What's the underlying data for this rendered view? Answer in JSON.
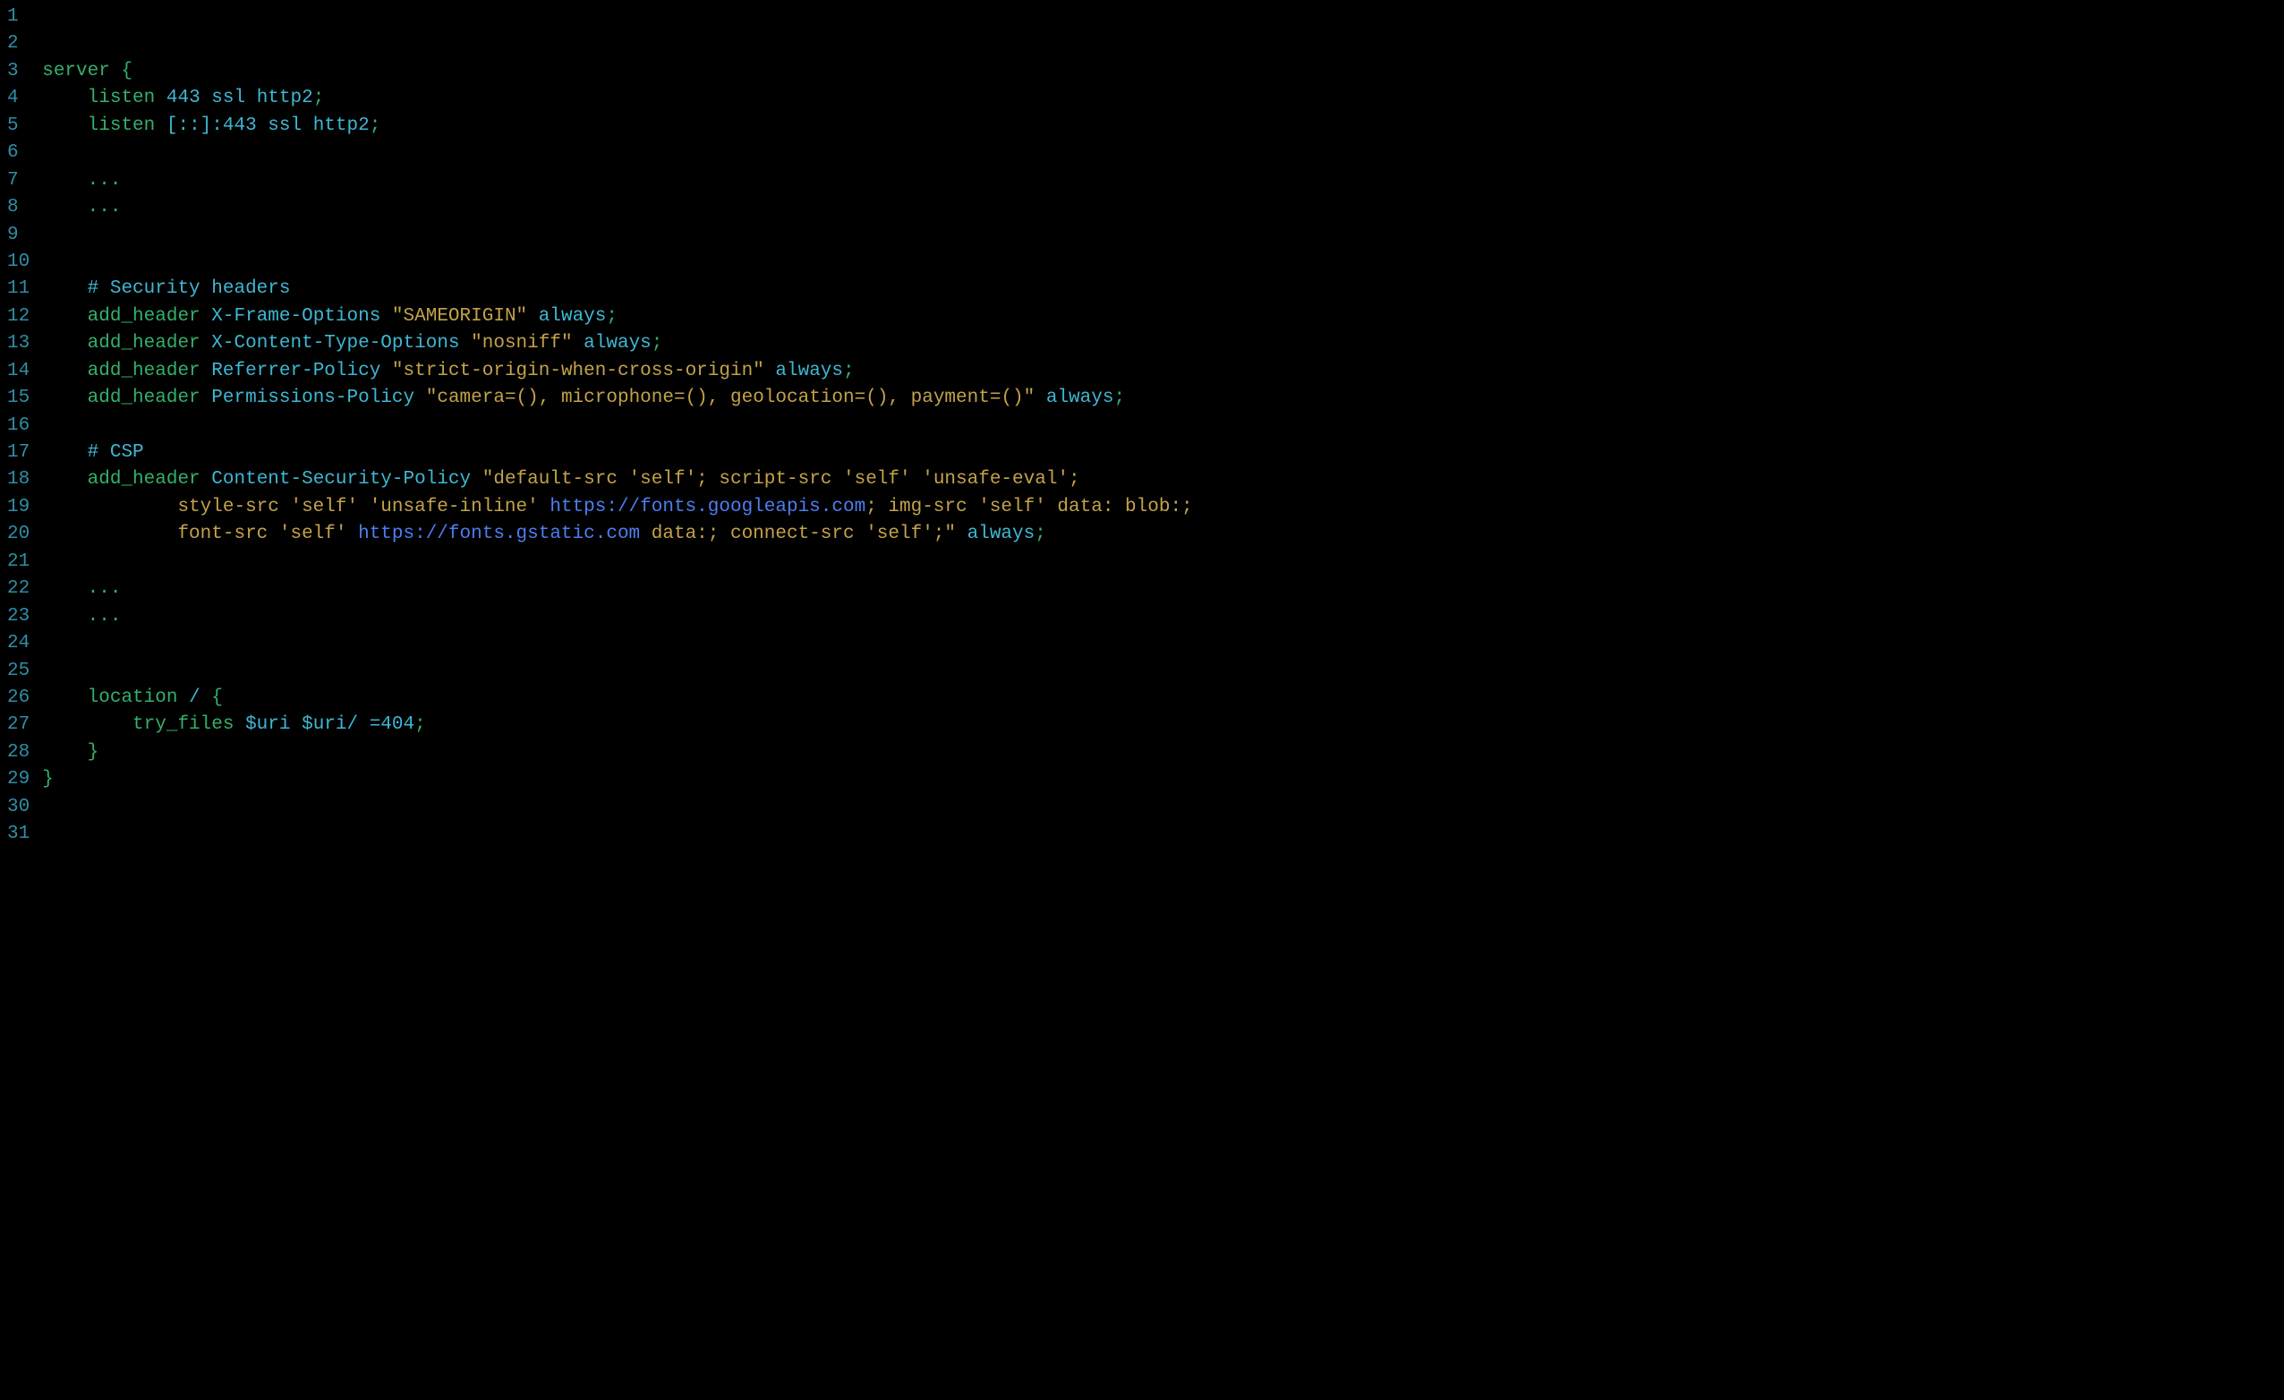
{
  "colors": {
    "background": "#000000",
    "gutter": "#2f8ea6",
    "keyword": "#33b06a",
    "comment": "#3fb7d3",
    "string": "#c3a24a",
    "link": "#4d7df0",
    "default": "#d0d0d0"
  },
  "code_lines": [
    {
      "n": 1,
      "t": []
    },
    {
      "n": 2,
      "t": []
    },
    {
      "n": 3,
      "t": [
        {
          "c": "tg",
          "v": "server {"
        }
      ]
    },
    {
      "n": 4,
      "t": [
        {
          "c": "td",
          "v": "    "
        },
        {
          "c": "tg",
          "v": "listen"
        },
        {
          "c": "td",
          "v": " "
        },
        {
          "c": "tc",
          "v": "443 ssl http2"
        },
        {
          "c": "tg",
          "v": ";"
        }
      ]
    },
    {
      "n": 5,
      "t": [
        {
          "c": "td",
          "v": "    "
        },
        {
          "c": "tg",
          "v": "listen"
        },
        {
          "c": "td",
          "v": " "
        },
        {
          "c": "tc",
          "v": "[::]:443 ssl http2"
        },
        {
          "c": "tg",
          "v": ";"
        }
      ]
    },
    {
      "n": 6,
      "t": []
    },
    {
      "n": 7,
      "t": [
        {
          "c": "td",
          "v": "    "
        },
        {
          "c": "tg",
          "v": "..."
        }
      ]
    },
    {
      "n": 8,
      "t": [
        {
          "c": "td",
          "v": "    "
        },
        {
          "c": "tg",
          "v": "..."
        }
      ]
    },
    {
      "n": 9,
      "t": []
    },
    {
      "n": 10,
      "t": []
    },
    {
      "n": 11,
      "t": [
        {
          "c": "td",
          "v": "    "
        },
        {
          "c": "tc",
          "v": "# Security headers"
        }
      ]
    },
    {
      "n": 12,
      "t": [
        {
          "c": "td",
          "v": "    "
        },
        {
          "c": "tg",
          "v": "add_header"
        },
        {
          "c": "td",
          "v": " "
        },
        {
          "c": "tc",
          "v": "X-Frame-Options "
        },
        {
          "c": "ts",
          "v": "\"SAMEORIGIN\""
        },
        {
          "c": "tc",
          "v": " always"
        },
        {
          "c": "tg",
          "v": ";"
        }
      ]
    },
    {
      "n": 13,
      "t": [
        {
          "c": "td",
          "v": "    "
        },
        {
          "c": "tg",
          "v": "add_header"
        },
        {
          "c": "td",
          "v": " "
        },
        {
          "c": "tc",
          "v": "X-Content-Type-Options "
        },
        {
          "c": "ts",
          "v": "\"nosniff\""
        },
        {
          "c": "tc",
          "v": " always"
        },
        {
          "c": "tg",
          "v": ";"
        }
      ]
    },
    {
      "n": 14,
      "t": [
        {
          "c": "td",
          "v": "    "
        },
        {
          "c": "tg",
          "v": "add_header"
        },
        {
          "c": "td",
          "v": " "
        },
        {
          "c": "tc",
          "v": "Referrer-Policy "
        },
        {
          "c": "ts",
          "v": "\"strict-origin-when-cross-origin\""
        },
        {
          "c": "tc",
          "v": " always"
        },
        {
          "c": "tg",
          "v": ";"
        }
      ]
    },
    {
      "n": 15,
      "t": [
        {
          "c": "td",
          "v": "    "
        },
        {
          "c": "tg",
          "v": "add_header"
        },
        {
          "c": "td",
          "v": " "
        },
        {
          "c": "tc",
          "v": "Permissions-Policy "
        },
        {
          "c": "ts",
          "v": "\"camera=(), microphone=(), geolocation=(), payment=()\""
        },
        {
          "c": "tc",
          "v": " always"
        },
        {
          "c": "tg",
          "v": ";"
        }
      ]
    },
    {
      "n": 16,
      "t": []
    },
    {
      "n": 17,
      "t": [
        {
          "c": "td",
          "v": "    "
        },
        {
          "c": "tc",
          "v": "# CSP"
        }
      ]
    },
    {
      "n": 18,
      "t": [
        {
          "c": "td",
          "v": "    "
        },
        {
          "c": "tg",
          "v": "add_header"
        },
        {
          "c": "td",
          "v": " "
        },
        {
          "c": "tc",
          "v": "Content-Security-Policy "
        },
        {
          "c": "ts",
          "v": "\"default-src 'self'; script-src 'self' 'unsafe-eval';"
        }
      ]
    },
    {
      "n": 19,
      "t": [
        {
          "c": "td",
          "v": "            "
        },
        {
          "c": "ts",
          "v": "style-src 'self' 'unsafe-inline' "
        },
        {
          "c": "tl",
          "v": "https://fonts.googleapis.com"
        },
        {
          "c": "ts",
          "v": "; img-src 'self' data: blob:;"
        }
      ]
    },
    {
      "n": 20,
      "t": [
        {
          "c": "td",
          "v": "            "
        },
        {
          "c": "ts",
          "v": "font-src 'self' "
        },
        {
          "c": "tl",
          "v": "https://fonts.gstatic.com"
        },
        {
          "c": "ts",
          "v": " data:; connect-src 'self';\""
        },
        {
          "c": "tc",
          "v": " always"
        },
        {
          "c": "tg",
          "v": ";"
        }
      ]
    },
    {
      "n": 21,
      "t": []
    },
    {
      "n": 22,
      "t": [
        {
          "c": "td",
          "v": "    "
        },
        {
          "c": "tg",
          "v": "..."
        }
      ]
    },
    {
      "n": 23,
      "t": [
        {
          "c": "td",
          "v": "    "
        },
        {
          "c": "tg",
          "v": "..."
        }
      ]
    },
    {
      "n": 24,
      "t": []
    },
    {
      "n": 25,
      "t": []
    },
    {
      "n": 26,
      "t": [
        {
          "c": "td",
          "v": "    "
        },
        {
          "c": "tg",
          "v": "location"
        },
        {
          "c": "td",
          "v": " "
        },
        {
          "c": "tc",
          "v": "/ "
        },
        {
          "c": "tg",
          "v": "{"
        }
      ]
    },
    {
      "n": 27,
      "t": [
        {
          "c": "td",
          "v": "        "
        },
        {
          "c": "tg",
          "v": "try_files"
        },
        {
          "c": "td",
          "v": " "
        },
        {
          "c": "tc",
          "v": "$uri $uri/ =404"
        },
        {
          "c": "tg",
          "v": ";"
        }
      ]
    },
    {
      "n": 28,
      "t": [
        {
          "c": "td",
          "v": "    "
        },
        {
          "c": "tg",
          "v": "}"
        }
      ]
    },
    {
      "n": 29,
      "t": [
        {
          "c": "tg",
          "v": "}"
        }
      ]
    },
    {
      "n": 30,
      "t": []
    },
    {
      "n": 31,
      "t": []
    }
  ]
}
